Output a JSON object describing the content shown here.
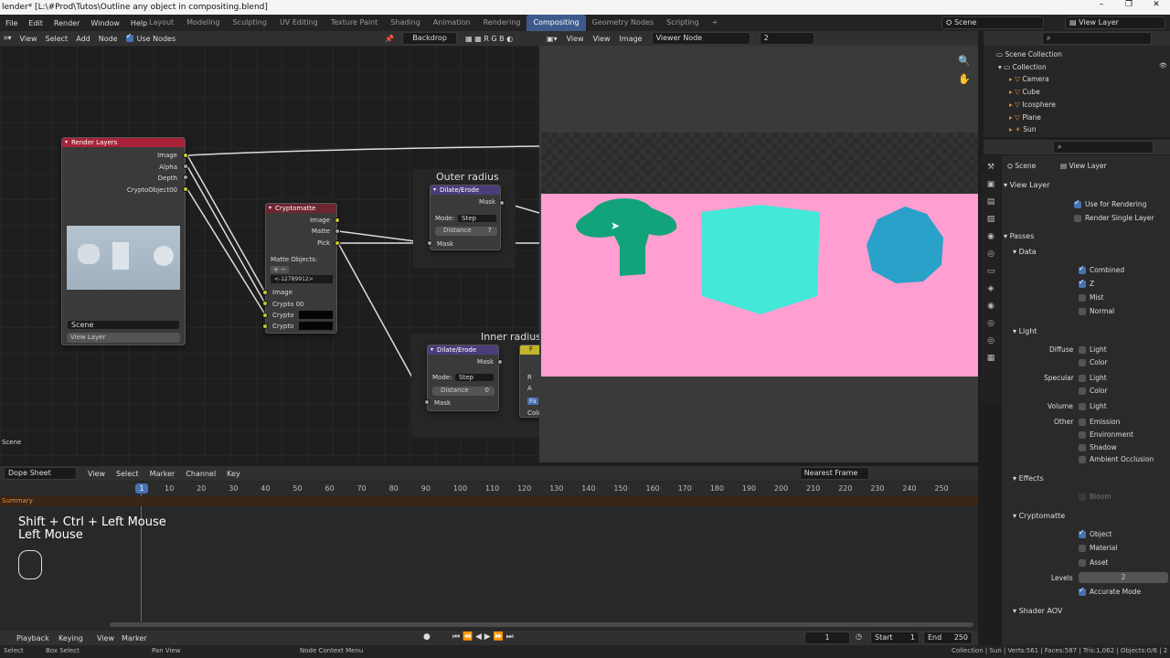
{
  "window": {
    "title": "lender* [L:\\#Prod\\Tutos\\Outline any object in compositing.blend]",
    "btn_min": "–",
    "btn_max": "❐",
    "btn_close": "✕"
  },
  "menu": [
    "File",
    "Edit",
    "Render",
    "Window",
    "Help"
  ],
  "workspace_tabs": [
    "Layout",
    "Modeling",
    "Sculpting",
    "UV Editing",
    "Texture Paint",
    "Shading",
    "Animation",
    "Rendering",
    "Compositing",
    "Geometry Nodes",
    "Scripting"
  ],
  "active_tab": "Compositing",
  "scene_field": "Scene",
  "viewlayer_field": "View Layer",
  "node_header": {
    "view": "View",
    "select": "Select",
    "add": "Add",
    "node": "Node",
    "use_nodes": "Use Nodes",
    "backdrop": "Backdrop"
  },
  "image_header": {
    "view": "View",
    "view2": "View",
    "image": "Image",
    "viewer_node": "Viewer Node",
    "slot": "2"
  },
  "nodes": {
    "render_layers": {
      "title": "Render Layers",
      "outputs": [
        "Image",
        "Alpha",
        "Depth",
        "CryptoObject00"
      ],
      "scene": "Scene",
      "layer": "View Layer"
    },
    "cryptomatte": {
      "title": "Cryptomatte",
      "outputs": [
        "Image",
        "Matte",
        "Pick"
      ],
      "matte_label": "Matte Objects:",
      "matte_value": "<-12789912>",
      "inputs": [
        "Image",
        "Crypto 00",
        "Crypto",
        "Crypto"
      ]
    },
    "outer_radius": {
      "frame": "Outer radius",
      "title": "Dilate/Erode",
      "out": "Mask",
      "mode_label": "Mode:",
      "mode": "Step",
      "distance_label": "Distance",
      "distance": "7",
      "in": "Mask"
    },
    "inner_radius": {
      "frame": "Inner radius",
      "title": "Dilate/Erode",
      "out": "Mask",
      "mode_label": "Mode:",
      "mode": "Step",
      "distance_label": "Distance",
      "distance": "0",
      "in": "Mask"
    },
    "partial_letters": {
      "f": "F",
      "r": "R",
      "a": "A",
      "fa": "Fa",
      "colo": "Colo"
    }
  },
  "node_editor_footer": "Scene",
  "outliner": {
    "root": "Scene Collection",
    "collection": "Collection",
    "items": [
      "Camera",
      "Cube",
      "Icosphere",
      "Plane",
      "Sun"
    ]
  },
  "properties": {
    "scene": "Scene",
    "view_layer": "View Layer",
    "panel_view_layer": "View Layer",
    "use_for_rendering": "Use for Rendering",
    "render_single_layer": "Render Single Layer",
    "passes": "Passes",
    "data": "Data",
    "combined": "Combined",
    "z": "Z",
    "mist": "Mist",
    "normal": "Normal",
    "light": "Light",
    "diffuse": "Diffuse",
    "specular": "Specular",
    "volume": "Volume",
    "other": "Other",
    "light_opt": "Light",
    "color_opt": "Color",
    "emission": "Emission",
    "environment": "Environment",
    "shadow": "Shadow",
    "ambient_occlusion": "Ambient Occlusion",
    "effects": "Effects",
    "bloom": "Bloom",
    "cryptomatte": "Cryptomatte",
    "object": "Object",
    "material": "Material",
    "asset": "Asset",
    "levels_label": "Levels",
    "levels": "2",
    "accurate_mode": "Accurate Mode",
    "shader_aov": "Shader AOV"
  },
  "timeline": {
    "editor": "Dope Sheet",
    "view": "View",
    "select": "Select",
    "marker": "Marker",
    "channel": "Channel",
    "key": "Key",
    "snap": "Nearest Frame",
    "summary": "Summary",
    "current_frame": "1",
    "ticks": [
      "10",
      "20",
      "30",
      "40",
      "50",
      "60",
      "70",
      "80",
      "90",
      "100",
      "110",
      "120",
      "130",
      "140",
      "150",
      "160",
      "170",
      "180",
      "190",
      "200",
      "210",
      "220",
      "230",
      "240",
      "250"
    ],
    "shortcut_line1": "Shift + Ctrl + Left Mouse",
    "shortcut_line2": "Left Mouse"
  },
  "playback": {
    "playback": "Playback",
    "keying": "Keying",
    "view": "View",
    "marker": "Marker",
    "frame": "1",
    "start_label": "Start",
    "start": "1",
    "end_label": "End",
    "end": "250"
  },
  "status": {
    "select": "Select",
    "box_select": "Box Select",
    "pan_view": "Pan View",
    "node_context": "Node Context Menu",
    "stats": "Collection | Sun | Verts:561 | Faces:587 | Tris:1,062 | Objects:0/6 | 2"
  },
  "colors": {
    "accent": "#4772b3",
    "pink": "#ff9ed0",
    "green": "#13a37b",
    "cyan": "#43e8d8",
    "blue": "#2aa1c9",
    "render_header": "#a8233a",
    "crypto_header": "#6e2530",
    "dilate_header": "#4c3d7a"
  }
}
